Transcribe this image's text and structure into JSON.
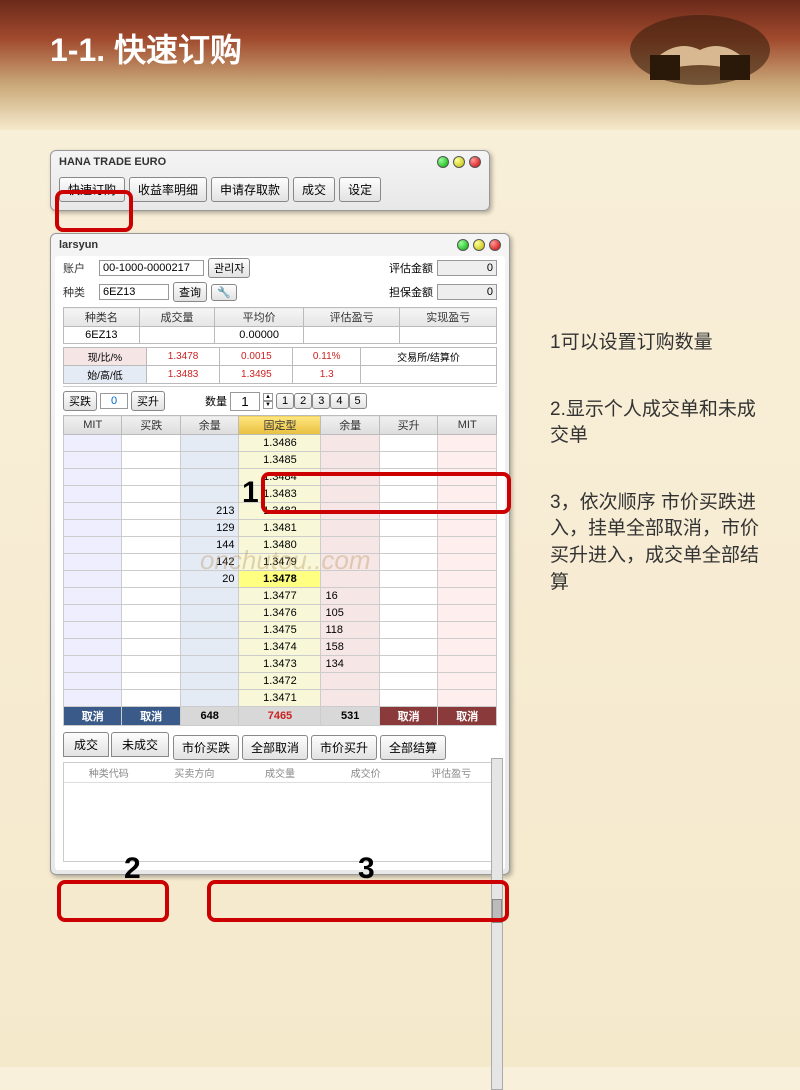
{
  "header": {
    "title": "1-1. 快速订购"
  },
  "watermark": "onchutou..com",
  "win1": {
    "title": "HANA TRADE EURO",
    "buttons": [
      "快速订购",
      "收益率明细",
      "申请存取款",
      "成交",
      "设定"
    ]
  },
  "win2": {
    "title": "larsyun",
    "account_label": "账户",
    "account": "00-1000-0000217",
    "admin": "관리자",
    "eval_label": "评估金额",
    "eval": "0",
    "kind_label": "种类",
    "kind": "6EZ13",
    "query": "查询",
    "margin_label": "担保金额",
    "margin": "0",
    "cols1": [
      "种类名",
      "成交量",
      "平均价",
      "评估盈亏",
      "实现盈亏"
    ],
    "row1": [
      "6EZ13",
      "",
      "0.00000",
      "",
      ""
    ],
    "stat1_lbl": "现/比/%",
    "stat1": [
      "1.3478",
      "0.0015",
      "0.11%"
    ],
    "stat1b": "交易所/结算价",
    "stat2_lbl": "始/高/低",
    "stat2": [
      "1.3483",
      "1.3495",
      "1.3"
    ],
    "buyfall": "买跌",
    "buyfall_v": "0",
    "buyrise": "买升",
    "qty_lbl": "数量",
    "qty": "1",
    "qtybtns": [
      "1",
      "2",
      "3",
      "4",
      "5"
    ],
    "ladder_cols": [
      "MIT",
      "买跌",
      "余量",
      "固定型",
      "余量",
      "买升",
      "MIT"
    ],
    "ladder": [
      {
        "bid": "",
        "price": "1.3486",
        "ask": ""
      },
      {
        "bid": "",
        "price": "1.3485",
        "ask": ""
      },
      {
        "bid": "",
        "price": "1.3484",
        "ask": ""
      },
      {
        "bid": "",
        "price": "1.3483",
        "ask": ""
      },
      {
        "bid": "213",
        "price": "1.3482",
        "ask": ""
      },
      {
        "bid": "129",
        "price": "1.3481",
        "ask": ""
      },
      {
        "bid": "144",
        "price": "1.3480",
        "ask": ""
      },
      {
        "bid": "142",
        "price": "1.3479",
        "ask": ""
      },
      {
        "bid": "20",
        "price": "1.3478",
        "ask": "",
        "cur": true
      },
      {
        "bid": "",
        "price": "1.3477",
        "ask": "16"
      },
      {
        "bid": "",
        "price": "1.3476",
        "ask": "105"
      },
      {
        "bid": "",
        "price": "1.3475",
        "ask": "118"
      },
      {
        "bid": "",
        "price": "1.3474",
        "ask": "158"
      },
      {
        "bid": "",
        "price": "1.3473",
        "ask": "134"
      },
      {
        "bid": "",
        "price": "1.3472",
        "ask": ""
      },
      {
        "bid": "",
        "price": "1.3471",
        "ask": ""
      }
    ],
    "summary": {
      "cancel": "取消",
      "bid_sum": "648",
      "mid": "7465",
      "ask_sum": "531"
    },
    "tabs": [
      "成交",
      "未成交"
    ],
    "actions": [
      "市价买跌",
      "全部取消",
      "市价买升",
      "全部结算"
    ],
    "bottom_cols": [
      "种类代码",
      "买卖方向",
      "成交量",
      "成交价",
      "评估盈亏"
    ]
  },
  "notes": {
    "n1": "1可以设置订购数量",
    "n2": "2.显示个人成交单和未成交单",
    "n3": "3，依次顺序 市价买跌进入，挂单全部取消，市价买升进入，成交单全部结算"
  }
}
